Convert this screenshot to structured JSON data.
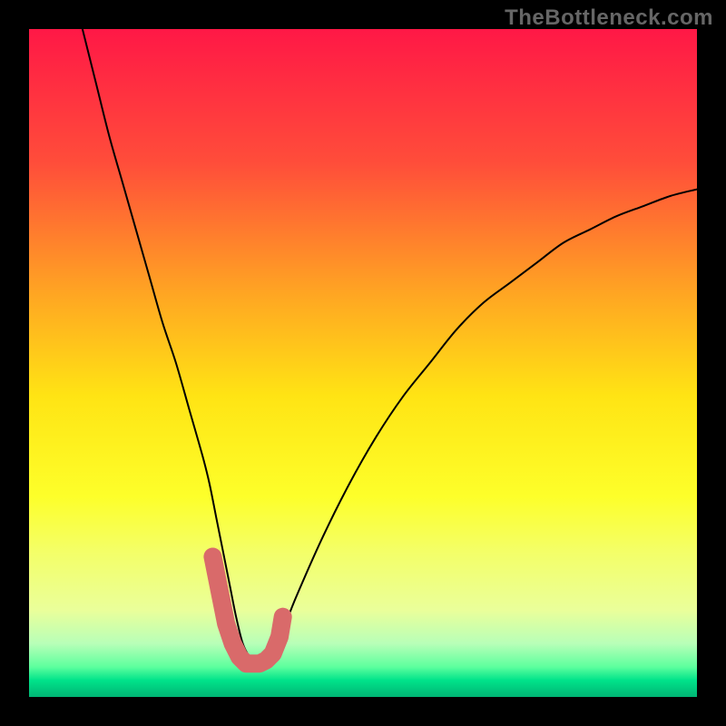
{
  "watermark": "TheBottleneck.com",
  "chart_data": {
    "type": "line",
    "title": "",
    "xlabel": "",
    "ylabel": "",
    "xlim": [
      0,
      100
    ],
    "ylim": [
      0,
      100
    ],
    "gradient_stops": [
      {
        "offset": 0.0,
        "color": "#ff1846"
      },
      {
        "offset": 0.2,
        "color": "#ff4d3a"
      },
      {
        "offset": 0.4,
        "color": "#ffa722"
      },
      {
        "offset": 0.55,
        "color": "#ffe414"
      },
      {
        "offset": 0.7,
        "color": "#fdff2a"
      },
      {
        "offset": 0.78,
        "color": "#f4ff66"
      },
      {
        "offset": 0.87,
        "color": "#eaff9a"
      },
      {
        "offset": 0.92,
        "color": "#b8ffb8"
      },
      {
        "offset": 0.955,
        "color": "#5dff9e"
      },
      {
        "offset": 0.975,
        "color": "#00e38a"
      },
      {
        "offset": 1.0,
        "color": "#00b574"
      }
    ],
    "series": [
      {
        "name": "bottleneck-curve",
        "x": [
          8,
          10,
          12,
          14,
          16,
          18,
          20,
          22,
          24,
          26,
          27,
          28,
          29,
          30,
          31,
          32,
          33,
          34,
          35,
          36,
          38,
          40,
          44,
          48,
          52,
          56,
          60,
          64,
          68,
          72,
          76,
          80,
          84,
          88,
          92,
          96,
          100
        ],
        "y": [
          100,
          92,
          84,
          77,
          70,
          63,
          56,
          50,
          43,
          36,
          32,
          27,
          22,
          17,
          12,
          8,
          6,
          5,
          5,
          6,
          10,
          15,
          24,
          32,
          39,
          45,
          50,
          55,
          59,
          62,
          65,
          68,
          70,
          72,
          73.5,
          75,
          76
        ]
      },
      {
        "name": "sweet-spot-marker",
        "x": [
          27.5,
          28.5,
          29.5,
          30.5,
          31.5,
          32.5,
          33.5,
          34.5,
          35.5,
          36.5,
          37.5,
          38.0
        ],
        "y": [
          21,
          16,
          11,
          8,
          6,
          5,
          5,
          5,
          5.5,
          6.5,
          9,
          12
        ]
      }
    ],
    "marker_color": "#d96a6a",
    "curve_color": "#000000"
  }
}
